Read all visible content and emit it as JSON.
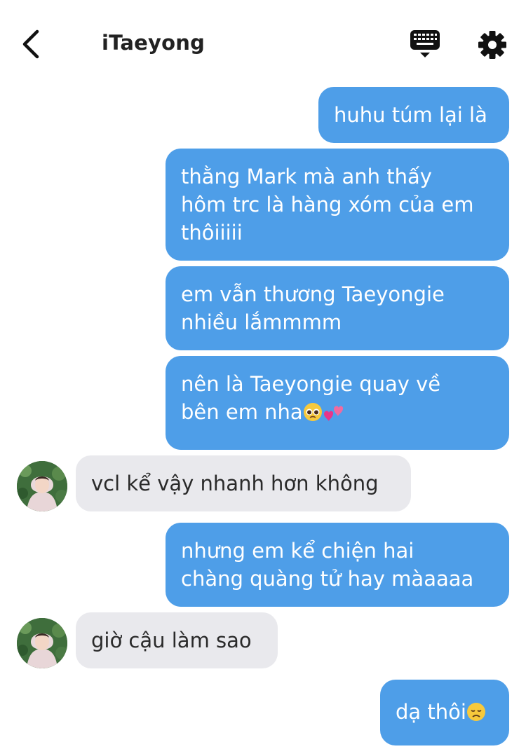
{
  "header": {
    "title": "iTaeyong",
    "back_icon": "chevron-left-icon",
    "keyboard_icon": "keyboard-icon",
    "settings_icon": "gear-icon"
  },
  "colors": {
    "sent_bubble": "#4e9ee8",
    "received_bubble": "#e9e9ed",
    "sent_text": "#ffffff",
    "received_text": "#2a2a2a"
  },
  "messages": [
    {
      "side": "sent",
      "text": "huhu túm lại là"
    },
    {
      "side": "sent",
      "lines": [
        "thằng Mark mà anh thấy",
        "hôm trc là hàng xóm của em",
        "thôiiiii"
      ]
    },
    {
      "side": "sent",
      "lines": [
        "em vẫn thương Taeyongie",
        "nhiều lắmmmm"
      ]
    },
    {
      "side": "sent",
      "lines": [
        "nên là Taeyongie quay về",
        "bên em nha"
      ],
      "emoji": [
        "pleading-face",
        "two-hearts"
      ]
    },
    {
      "side": "received",
      "text": "vcl kể vậy nhanh hơn không"
    },
    {
      "side": "sent",
      "lines": [
        "nhưng em kể chiện hai",
        "chàng quàng tử hay màaaaa"
      ]
    },
    {
      "side": "received",
      "text": "giờ cậu làm sao"
    },
    {
      "side": "sent",
      "text": "dạ thôi",
      "emoji": [
        "disappointed-face"
      ]
    }
  ]
}
